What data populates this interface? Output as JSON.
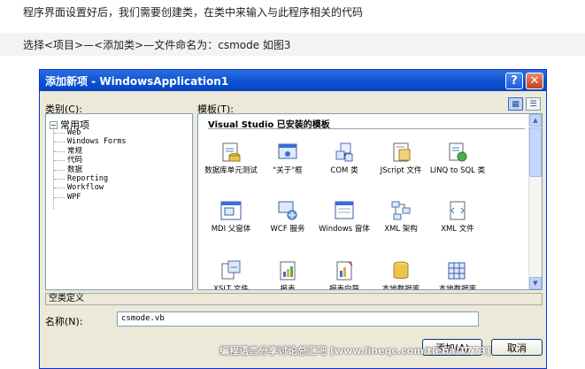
{
  "article": {
    "line1": "程序界面设置好后，我们需要创建类，在类中来输入与此程序相关的代码",
    "line2": "选择<项目>—<添加类>—文件命名为：csmode 如图3"
  },
  "dialog": {
    "title": "添加新项 - WindowsApplication1",
    "help_label": "?",
    "close_label": "✕",
    "categories_label": "类别(C):",
    "templates_label": "模板(T):",
    "templates_header": "Visual Studio 已安装的模板",
    "tree": {
      "root": "常用项",
      "toggle": "−",
      "children": [
        "Web",
        "Windows Forms",
        "常规",
        "代码",
        "数据",
        "Reporting",
        "Workflow",
        "WPF"
      ]
    },
    "templates": [
      {
        "label": "数据库单元测试",
        "icon": "database-unit-test-icon"
      },
      {
        "label": "\"关于\"框",
        "icon": "about-box-icon"
      },
      {
        "label": "COM 类",
        "icon": "com-class-icon"
      },
      {
        "label": "JScript 文件",
        "icon": "jscript-file-icon"
      },
      {
        "label": "LINQ to SQL 类",
        "icon": "linq-to-sql-icon"
      },
      {
        "label": "MDI 父窗体",
        "icon": "mdi-parent-form-icon"
      },
      {
        "label": "WCF 服务",
        "icon": "wcf-service-icon"
      },
      {
        "label": "Windows 窗体",
        "icon": "windows-form-icon"
      },
      {
        "label": "XML 架构",
        "icon": "xml-schema-icon"
      },
      {
        "label": "XML 文件",
        "icon": "xml-file-icon"
      },
      {
        "label": "XSLT 文件",
        "icon": "xslt-file-icon"
      },
      {
        "label": "报表",
        "icon": "report-icon"
      },
      {
        "label": "报表向导",
        "icon": "report-wizard-icon"
      },
      {
        "label": "本地数据库",
        "icon": "local-database-icon"
      },
      {
        "label": "本地数据库",
        "icon": "local-database-cache-icon"
      }
    ],
    "description": "空类定义",
    "name_label": "名称(N):",
    "name_value": "csmode.vb",
    "add_label": "添加(A)",
    "cancel_label": "取消"
  },
  "watermark": "编程语言分享讨论总汇吧 [www.lineqc.com/tieba/1773]",
  "colors": {
    "titlebar": "#0a4fd0",
    "dialog_bg": "#ece9d8",
    "border": "#7f9db9"
  }
}
